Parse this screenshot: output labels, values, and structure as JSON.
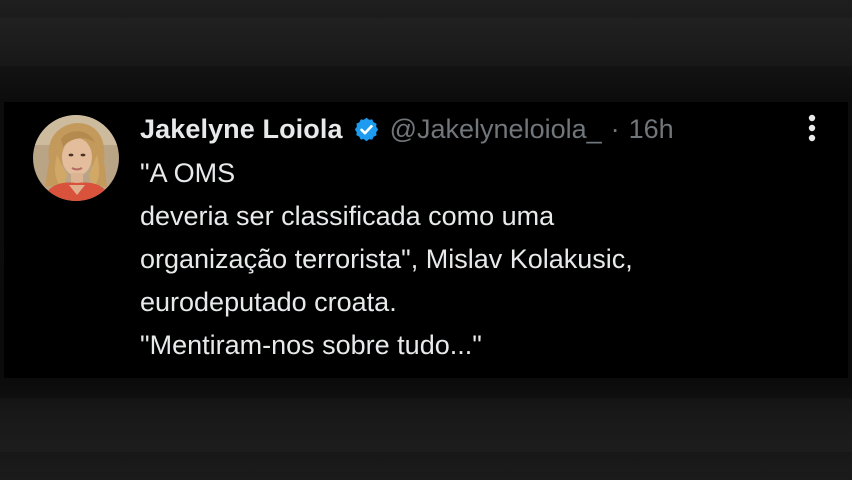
{
  "tweet": {
    "author": {
      "display_name": "Jakelyne Loiola",
      "handle": "@Jakelyneloiola_",
      "verified": true,
      "avatar_icon": "profile-photo"
    },
    "separator": "·",
    "time": "16h",
    "more_icon": "more-vertical-icon",
    "text_lines": [
      "\"A OMS",
      "deveria ser classificada como uma",
      "organização terrorista\", Mislav Kolakusic,",
      "eurodeputado croata.",
      "\"Mentiram-nos sobre tudo...\""
    ]
  },
  "colors": {
    "card_background": "#000000",
    "primary_text": "#e7e9ea",
    "secondary_text": "#71767b",
    "verified_badge": "#1d9bf0"
  }
}
